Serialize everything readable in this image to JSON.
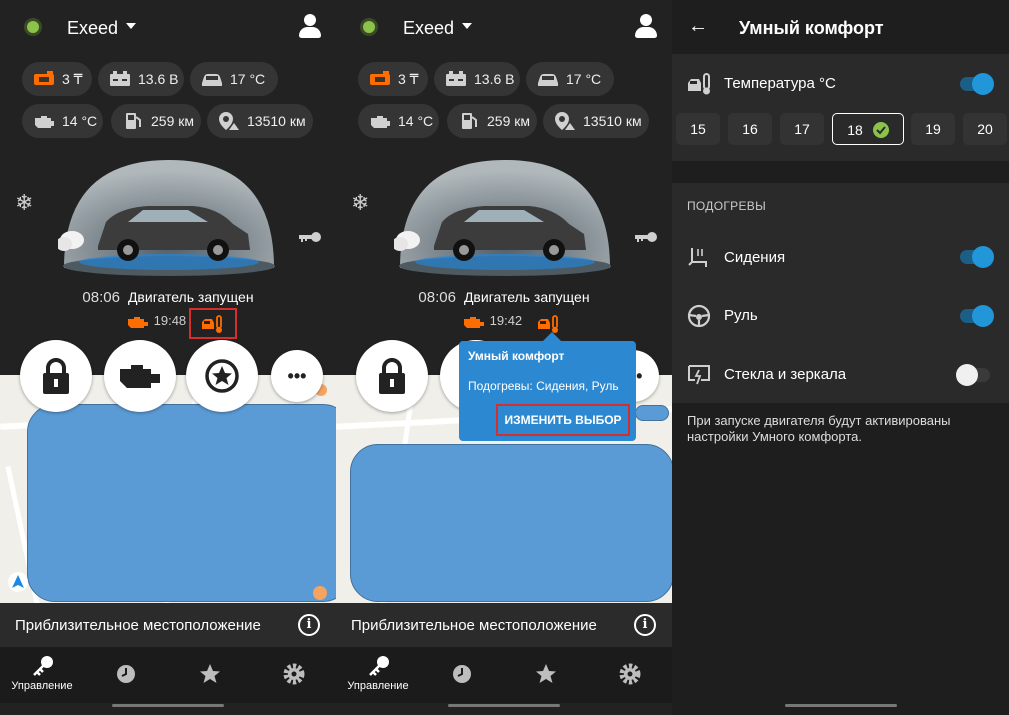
{
  "header": {
    "car_name": "Exeed"
  },
  "chips": [
    {
      "icon": "fuel-tank-icon",
      "value": "3 ₸"
    },
    {
      "icon": "battery-icon",
      "value": "13.6 В"
    },
    {
      "icon": "car-interior-temp-icon",
      "value": "17 °C"
    },
    {
      "icon": "engine-temp-icon",
      "value": "14 °C"
    },
    {
      "icon": "fuel-range-icon",
      "value": "259 км"
    },
    {
      "icon": "odometer-location-icon",
      "value": "13510 км"
    }
  ],
  "status": {
    "time": "08:06",
    "text": "Двигатель запущен"
  },
  "screen1": {
    "engine_time": "19:48"
  },
  "screen2": {
    "engine_time": "19:42"
  },
  "actions": {
    "more_label": "•••"
  },
  "popup": {
    "title": "Умный комфорт",
    "subtitle": "Подогревы: Сидения, Руль",
    "button": "ИЗМЕНИТЬ ВЫБОР"
  },
  "location": {
    "label": "Приблизительное местоположение"
  },
  "bottom_nav": {
    "control_label": "Управление"
  },
  "comfort": {
    "title": "Умный комфорт",
    "temperature_label": "Температура °C",
    "temperature_on": true,
    "temps": [
      "15",
      "16",
      "17",
      "18",
      "19",
      "20"
    ],
    "selected_temp": "18",
    "heating_section": "ПОДОГРЕВЫ",
    "seats_label": "Сидения",
    "seats_on": true,
    "wheel_label": "Руль",
    "wheel_on": true,
    "glass_label": "Стекла и зеркала",
    "glass_on": false,
    "note": "При запуске двигателя будут активированы настройки Умного комфорта."
  },
  "colors": {
    "accent_orange": "#ff6d00",
    "toggle_blue": "#2196d9",
    "popup_blue": "#2c89d1",
    "highlight_red": "#d32f2f"
  }
}
